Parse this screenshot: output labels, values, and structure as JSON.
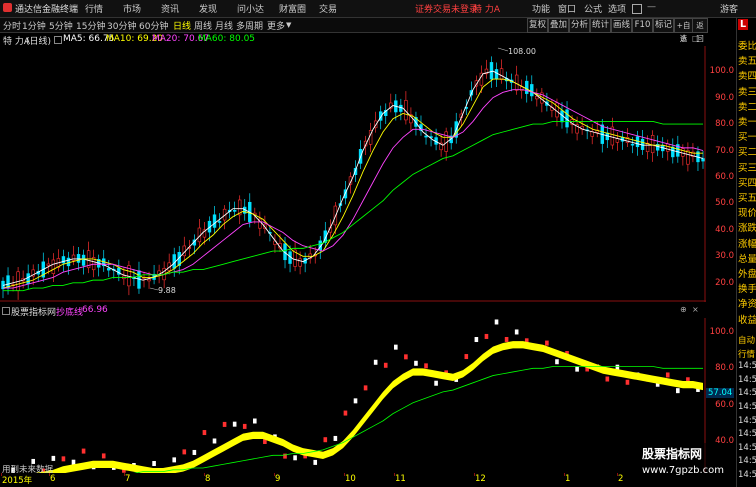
{
  "app": {
    "title": "通达信金融终端"
  },
  "menu": [
    "行情",
    "市场",
    "资讯",
    "发现",
    "问小达",
    "财富圈",
    "交易"
  ],
  "menu_alert": "证券交易未登录",
  "menu_stock": "特 力A",
  "menu_right": [
    "功能",
    "窗口",
    "公式",
    "选项",
    "游客"
  ],
  "toolbar": {
    "periods": [
      "分时",
      "1分钟",
      "5分钟",
      "15分钟",
      "30分钟",
      "60分钟",
      "日线",
      "周线",
      "月线",
      "多周期",
      "更多"
    ],
    "selected": "日线",
    "right_buttons": [
      "复权",
      "叠加",
      "分析",
      "统计",
      "画线",
      "F10",
      "标记",
      "+自选",
      "返回"
    ]
  },
  "infobar": {
    "stock": "特 力A",
    "period": "(日线)",
    "ma5": "MA5: 66.75",
    "ma10": "MA10: 69.20",
    "ma20": "MA20: 70.67",
    "ma60": "MA60: 80.05"
  },
  "annotations": {
    "high": "108.00",
    "low": "9.88"
  },
  "main_axis": [
    "100.0",
    "90.0",
    "80.0",
    "70.0",
    "60.0",
    "50.0",
    "40.0",
    "30.0",
    "20.0"
  ],
  "indicator": {
    "title": "股票指标网",
    "name": "抄底线",
    "value": "66.96",
    "axis": [
      "100.0",
      "80.0",
      "60.0",
      "40.0"
    ],
    "marker": "57.04"
  },
  "time_axis": [
    "2015年",
    "6",
    "7",
    "8",
    "9",
    "10",
    "11",
    "12",
    "1",
    "2"
  ],
  "right_panel": [
    "委比",
    "卖五",
    "卖四",
    "卖三",
    "卖二",
    "卖一",
    "买一",
    "买二",
    "买三",
    "买四",
    "买五",
    "现价",
    "涨跌",
    "涨幅",
    "总量",
    "外盘",
    "换手",
    "净资",
    "收益"
  ],
  "right_panel_times": [
    "自动",
    "行情",
    "14:56",
    "14:56",
    "14:56",
    "14:56",
    "14:56",
    "14:56",
    "14:56",
    "14:56",
    "14:56"
  ],
  "right_badge": "L",
  "watermark": {
    "line1": "股票指标网",
    "line2": "www.7gpzb.com"
  },
  "future_label": "用到未来数据",
  "colors": {
    "up": "#ff3030",
    "down": "#00e0ff",
    "ma5": "#ffffff",
    "ma10": "#ffff00",
    "ma20": "#ff44ff",
    "ma60": "#00ff00",
    "band": "#ffff00"
  },
  "chart_data": {
    "type": "candlestick",
    "ylim": [
      15,
      108
    ],
    "series": [
      {
        "name": "MA5",
        "values": [
          19,
          20,
          21,
          23,
          25,
          27,
          28,
          29,
          29,
          28,
          27,
          25,
          23,
          22,
          21,
          22,
          24,
          27,
          31,
          35,
          39,
          42,
          45,
          48,
          48,
          46,
          42,
          37,
          32,
          29,
          28,
          30,
          35,
          43,
          52,
          60,
          70,
          78,
          84,
          87,
          86,
          82,
          77,
          74,
          72,
          75,
          84,
          93,
          99,
          100,
          98,
          96,
          94,
          92,
          89,
          86,
          83,
          80,
          78,
          77,
          76,
          75,
          74,
          73,
          72,
          72,
          71,
          70,
          69,
          68,
          67
        ]
      },
      {
        "name": "MA10",
        "values": [
          18,
          19,
          20,
          21,
          23,
          25,
          27,
          28,
          29,
          29,
          28,
          27,
          25,
          24,
          22,
          22,
          23,
          25,
          28,
          31,
          35,
          38,
          42,
          45,
          47,
          46,
          44,
          40,
          36,
          32,
          30,
          30,
          32,
          38,
          45,
          53,
          62,
          70,
          77,
          82,
          84,
          83,
          80,
          77,
          75,
          75,
          80,
          87,
          94,
          97,
          97,
          96,
          94,
          92,
          90,
          88,
          85,
          82,
          80,
          78,
          77,
          76,
          75,
          74,
          73,
          72,
          72,
          71,
          70,
          69,
          69
        ]
      },
      {
        "name": "MA20",
        "values": [
          18,
          18,
          19,
          20,
          21,
          22,
          24,
          25,
          26,
          27,
          27,
          27,
          26,
          25,
          24,
          23,
          23,
          24,
          25,
          27,
          30,
          33,
          36,
          39,
          42,
          43,
          43,
          41,
          39,
          36,
          34,
          33,
          32,
          34,
          38,
          44,
          51,
          58,
          65,
          71,
          75,
          78,
          78,
          77,
          76,
          75,
          77,
          81,
          86,
          90,
          92,
          93,
          93,
          92,
          91,
          89,
          87,
          85,
          83,
          81,
          79,
          78,
          77,
          76,
          75,
          74,
          73,
          72,
          71,
          71,
          70
        ]
      },
      {
        "name": "MA60",
        "values": [
          17,
          17,
          17,
          18,
          18,
          19,
          19,
          20,
          20,
          21,
          21,
          22,
          22,
          22,
          23,
          23,
          23,
          24,
          24,
          25,
          25,
          26,
          27,
          28,
          29,
          30,
          31,
          32,
          32,
          33,
          33,
          34,
          35,
          37,
          39,
          42,
          45,
          48,
          51,
          55,
          58,
          61,
          63,
          65,
          67,
          68,
          70,
          72,
          74,
          76,
          77,
          78,
          79,
          80,
          80,
          81,
          81,
          81,
          81,
          81,
          81,
          81,
          81,
          81,
          81,
          81,
          80,
          80,
          80,
          80,
          80
        ]
      }
    ]
  }
}
